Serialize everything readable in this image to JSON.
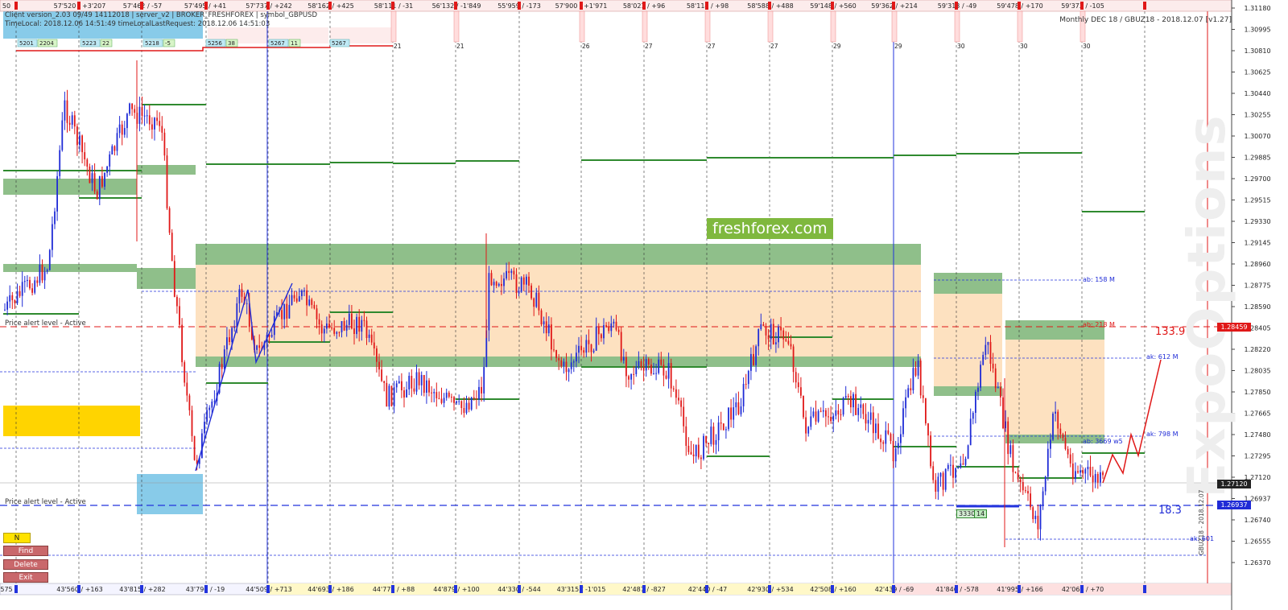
{
  "info": {
    "line1": "Client version_2.03 09/49 14112018 | server_v2 | BROKER_FRESHFOREX | symbol_GBPUSD",
    "line2": "TimeLocal: 2018.12.06 14:51:49 timeLocalLastRequest: 2018.12.06 14:51:03"
  },
  "chart_title": "Monthly DEC 18 / GBUZ18 - 2018.12.07 [v1.27]",
  "brand": "freshforex.com",
  "watermark": "ExpoOptions",
  "side_label": "GBUZ18 - 2018.12.07",
  "buttons": {
    "n": "N",
    "find": "Find",
    "delete": "Delete",
    "exit": "Exit"
  },
  "alerts": {
    "upper": "Price alert level - Active",
    "lower": "Price alert level - Active"
  },
  "values": {
    "upper": "133.9",
    "lower": "18.3"
  },
  "level_labels": [
    "ab: 158 M",
    "ab: 218 M",
    "ak: 612 M",
    "ab: 3669 w5",
    "ak: 798 M",
    "ak: 601"
  ],
  "box_label": {
    "a": "3330",
    "b": "14"
  },
  "colors": {
    "bull": "#1f2bd6",
    "bear": "#e01818",
    "zone_green": "#8fbf8a",
    "zone_orange": "#fde1c0",
    "zone_yellow": "#ffd400",
    "zone_blue": "#88cbe9",
    "level_green": "#2f8a2f"
  },
  "top_labels": [
    "50",
    "57'520 / +3'207",
    "57'462 / -57",
    "57'495 / +41",
    "57'737 / +242",
    "58'162 / +425",
    "58'111 / -31",
    "56'132 / -1'849",
    "55'959 / -173",
    "57'900 / +1'971",
    "58'021 / +96",
    "58'114 / +98",
    "58'588 / +488",
    "59'148 / +560",
    "59'362 / +214",
    "59'313 / -49",
    "59'478 / +170",
    "59'373 / -105"
  ],
  "bottom_labels": [
    "575",
    "43'560 / +163",
    "43'815 / +282",
    "43'796 / -19",
    "44'509 / +713",
    "44'693 / +186",
    "44'779 / +88",
    "44'879 / +100",
    "44'330 / -544",
    "43'315 / -1'015",
    "42'487 / -827",
    "42'440 / -47",
    "42'930 / +534",
    "42'508 / +160",
    "42'439 / -69",
    "41'846 / -578",
    "41'995 / +166",
    "42'062 / +70"
  ],
  "day_labels": [
    "21",
    "21",
    "26",
    "27",
    "27",
    "27",
    "29",
    "29",
    "30",
    "30",
    "30"
  ],
  "small_boxes": [
    [
      "5201",
      "2204"
    ],
    [
      "5223",
      "22"
    ],
    [
      "5218",
      "-5"
    ],
    [
      "5256",
      "38"
    ],
    [
      "5267",
      "11"
    ],
    [
      "5267",
      ""
    ]
  ],
  "price_axis": [
    "1.31180",
    "1.30995",
    "1.30810",
    "1.30625",
    "1.30440",
    "1.30255",
    "1.30070",
    "1.29885",
    "1.29700",
    "1.29515",
    "1.29330",
    "1.29145",
    "1.28960",
    "1.28775",
    "1.28590",
    "1.28405",
    "1.28220",
    "1.28035",
    "1.27850",
    "1.27665",
    "1.27480",
    "1.27295",
    "1.27120",
    "1.26937",
    "1.26740",
    "1.26555",
    "1.26370"
  ],
  "price_tags": {
    "red": "1.28459",
    "dark": "1.27120",
    "blue": "1.26937"
  }
}
